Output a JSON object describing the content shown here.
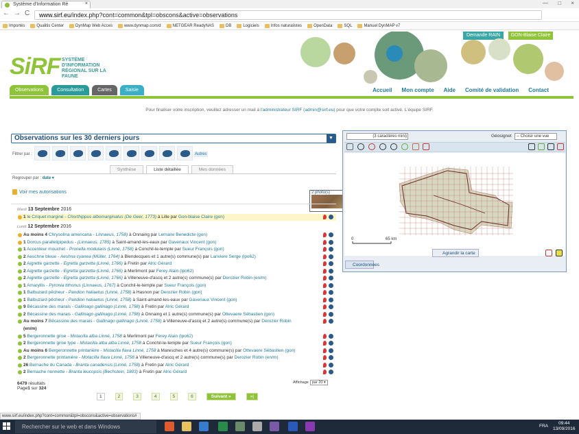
{
  "browser": {
    "tab_title": "Système d'Information Ré",
    "tab_close": "×",
    "url_host": "www.sirf.eu",
    "url_path": "/index.php?cont=common&tpl=obscons&active=observations",
    "window_controls": [
      "—",
      "□",
      "×"
    ],
    "nav": [
      "←",
      "→",
      "C",
      "⌂"
    ],
    "bookmarks": [
      "Importés",
      "Qualitis Center",
      "DynMap Web Acces",
      "www.dynmap.com/d",
      "NETGEAR ReadyNAS",
      "DB",
      "Logiciels",
      "Infos naturalistes",
      "OpenData",
      "SQL",
      "Manuel DynMAP v7"
    ]
  },
  "header": {
    "demande_rain": "Demande RAIN",
    "user_button": "GON-Blaise Claire",
    "logo_text": "SiRF",
    "logo_subtitle": "SYSTÈME D'INFORMATION RÉGIONAL SUR LA FAUNE",
    "main_nav": [
      {
        "label": "Observations",
        "color": "#8fc43a"
      },
      {
        "label": "Consultation",
        "color": "#2a9a9a"
      },
      {
        "label": "Cartes",
        "color": "#666666"
      },
      {
        "label": "Saisie",
        "color": "#3ab0c8"
      }
    ],
    "top_menu": [
      "Accueil",
      "Mon compte",
      "Aide",
      "Comité de validation",
      "Contact"
    ]
  },
  "notice": {
    "before": "Pour finaliser votre inscription, veuillez adresser un mail à ",
    "link": "l'administrateur SIRF (admin@sirf.eu)",
    "after": " pour que votre compte soit activé. L'équipe SIRF."
  },
  "observations": {
    "title": "Observations sur les 30 derniers jours",
    "filter_label": "Filtrer par :",
    "filter_icons": [
      "dragonfly-icon",
      "lizard-icon",
      "hedgehog-icon",
      "fish-icon",
      "frog-icon",
      "bird-icon",
      "grasshopper-icon",
      "bat-icon",
      "dolphin-icon"
    ],
    "autres": "Autres",
    "tabs": [
      "Synthèse",
      "Liste détaillée",
      "Mes données"
    ],
    "active_tab": "Liste détaillée",
    "regroup_label": "Regrouper par :",
    "regroup_value": "date ▾",
    "voir_autorisations": "Voir mes autorisations",
    "photo_popup": "2 photo(s)",
    "days": [
      {
        "weekday": "Mardi",
        "date": "13 Septembre",
        "year": "2016"
      },
      {
        "weekday": "Lundi",
        "date": "12 Septembre",
        "year": "2016"
      }
    ],
    "rows": [
      {
        "qty": "1",
        "species": "le Criquet marginé",
        "latin": "Chorthippus albomarginatus (De Geer, 1773)",
        "place": " à Lille par ",
        "observer": "Gon-blaise Claire (gon)",
        "dot": "y",
        "hl": true
      },
      {
        "qty": "Au moins 4",
        "species": "Chrysolina americana",
        "latin": "Linnaeus, 1758)",
        "place": " à Onnaing par ",
        "observer": "Lemaire Benedicte (gon)",
        "dot": "y",
        "hl": false
      },
      {
        "qty": "1",
        "species": "Dorcus parallelipipedus",
        "latin": "(Linnaeus, 1785)",
        "place": " à Saint-amand-les-eaux par ",
        "observer": "Gaveriaux Vincent (gon)",
        "dot": "y",
        "hl": false
      },
      {
        "qty": "1",
        "species": "Accenteur mouchet",
        "latin": "Prunella modularis (Linné, 1758)",
        "place": " à Conchil-le-temple par ",
        "observer": "Sueur François (gon)",
        "dot": "g",
        "hl": false
      },
      {
        "qty": "2",
        "species": "Aeschne bleue",
        "latin": "Aeshna cyanea (Müller, 1764)",
        "place": " à Blendecques et 1 autre(s) commune(s) par ",
        "observer": "Lariviere Serge (lpo62)",
        "dot": "g",
        "hl": false
      },
      {
        "qty": "2",
        "species": "Aigrette garzette",
        "latin": "Egretta garzetta (Linné, 1766)",
        "place": " à Fretin par ",
        "observer": "Alric Gérard",
        "dot": "g",
        "hl": false
      },
      {
        "qty": "2",
        "species": "Aigrette garzette",
        "latin": "Egretta garzetta (Linné, 1766)",
        "place": " à Merlimont par ",
        "observer": "Ferey Alain (lpo62)",
        "dot": "g",
        "hl": false
      },
      {
        "qty": "2",
        "species": "Aigrette garzette",
        "latin": "Egretta garzetta (Linné, 1766)",
        "place": " à Villeneuve-d'ascq et 2 autre(s) commune(s) par ",
        "observer": "Derozier Robin (en/m)",
        "dot": "g",
        "hl": false
      },
      {
        "qty": "1",
        "species": "Amaryllis",
        "latin": "Pyronia tithonus (Linnaeus, 1767)",
        "place": " à Conchil-le-temple par ",
        "observer": "Sueur François (gon)",
        "dot": "g",
        "hl": false
      },
      {
        "qty": "1",
        "species": "Balbuzard pêcheur",
        "latin": "Pandion haliaetus (Linné, 1758)",
        "place": " à Hasnon par ",
        "observer": "Derozier Robin (gon)",
        "dot": "g",
        "hl": false
      },
      {
        "qty": "1",
        "species": "Balbuzard pêcheur",
        "latin": "Pandion haliaetus (Linné, 1758)",
        "place": " à Saint-amand-les-eaux par ",
        "observer": "Gaveriaux Vincent (gon)",
        "dot": "g",
        "hl": false
      },
      {
        "qty": "9",
        "species": "Bécassine des marais",
        "latin": "Gallinago gallinago (Linné, 1758)",
        "place": " à Fretin par ",
        "observer": "Alric Gérard",
        "dot": "g",
        "hl": false
      },
      {
        "qty": "2",
        "species": "Bécassine des marais",
        "latin": "Gallinago gallinago (Linné, 1758)",
        "place": " à Onnaing et 1 autre(s) commune(s) par ",
        "observer": "Ottevaere Sébastien (gon)",
        "dot": "g",
        "hl": false
      },
      {
        "qty": "Au moins 7",
        "species": "Bécassine des marais",
        "latin": "Gallinago gallinago (Linné, 1758)",
        "place": " à Villeneuve-d'ascq et 2 autre(s) commune(s) par ",
        "observer": "Derozier Robin",
        "dot": "g",
        "hl": false
      },
      {
        "qty": "(en/m)",
        "species": "",
        "latin": "",
        "place": "",
        "observer": "",
        "dot": "n",
        "hl": false
      },
      {
        "qty": "5",
        "species": "Bergeronnette grise",
        "latin": "Motacilla alba Linné, 1758",
        "place": " à Merlimont par ",
        "observer": "Ferey Alain (lpo62)",
        "dot": "g",
        "hl": false
      },
      {
        "qty": "2",
        "species": "Bergeronnette grise type",
        "latin": "Motacilla alba alba Linné, 1758",
        "place": " à Conchil-le-temple par ",
        "observer": "Sueur François (gon)",
        "dot": "g",
        "hl": false
      },
      {
        "qty": "Au moins 6",
        "species": "Bergeronnette printanière",
        "latin": "Motacilla flava Linné, 1758",
        "place": " à Maresches et 4 autre(s) commune(s) par ",
        "observer": "Ottevaere Sébastien (gon)",
        "dot": "g",
        "hl": false
      },
      {
        "qty": "2",
        "species": "Bergeronnette printanière",
        "latin": "Motacilla flava Linné, 1758",
        "place": " à Villeneuve-d'ascq et 2 autre(s) commune(s) par ",
        "observer": "Derozier Robin (en/m)",
        "dot": "g",
        "hl": false
      },
      {
        "qty": "26",
        "species": "Bernache du Canada",
        "latin": "Branta canadensis (Linné, 1758)",
        "place": " à Fretin par ",
        "observer": "Alric Gérard",
        "dot": "g",
        "hl": false
      },
      {
        "qty": "2",
        "species": "Bernache nonnette",
        "latin": "Branta leucopsis (Bechstein, 1803)",
        "place": " à Fretin par ",
        "observer": "Alric Gérard",
        "dot": "g",
        "hl": false
      }
    ],
    "results_count": "6479",
    "results_label": " résultats",
    "page_label": "Page",
    "page_current": "1",
    "page_sur": " sur ",
    "page_total": "324",
    "affichage_label": "Affichage",
    "affichage_value": "par 20 ▾",
    "pages": [
      "1",
      "2",
      "3",
      "4",
      "5",
      "6"
    ],
    "next": "Suivant »",
    "last": "»|"
  },
  "map": {
    "search_placeholder": "(3 caractères mini)",
    "geosignet_label": "Géosignet",
    "geosignet_value": "-- Choisir une vue",
    "scale_start": "0",
    "scale_end": "65 km",
    "agrandir": "Agrandir la carte",
    "coordonnees": "Coordonnées"
  },
  "status_url": "www.sirf.eu/index.php?cont=common&tpl=obscons&active=observations#",
  "taskbar": {
    "search": "Rechercher sur le web et dans Windows",
    "lang": "FRA",
    "time": "09:44",
    "date": "13/09/2016"
  }
}
